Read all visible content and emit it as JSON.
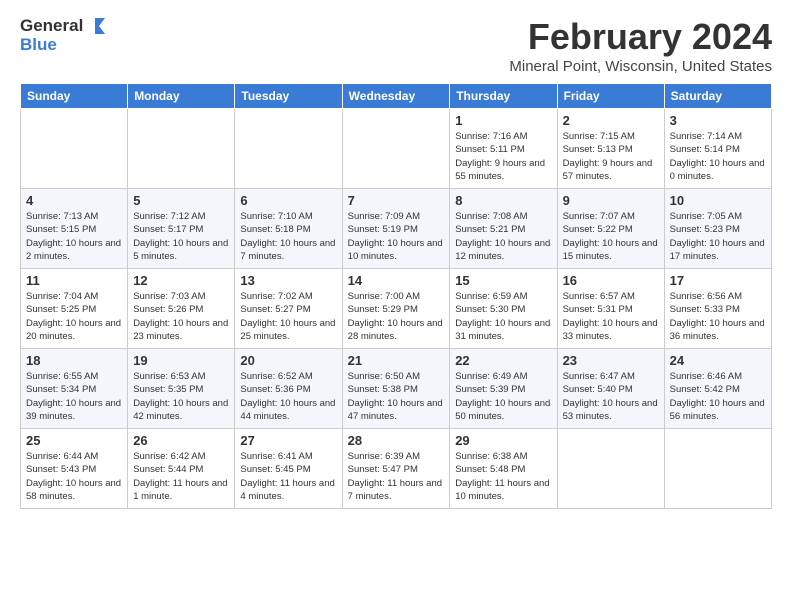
{
  "app": {
    "name_general": "General",
    "name_blue": "Blue"
  },
  "header": {
    "month_year": "February 2024",
    "location": "Mineral Point, Wisconsin, United States"
  },
  "columns": [
    "Sunday",
    "Monday",
    "Tuesday",
    "Wednesday",
    "Thursday",
    "Friday",
    "Saturday"
  ],
  "weeks": [
    [
      {
        "day": "",
        "info": ""
      },
      {
        "day": "",
        "info": ""
      },
      {
        "day": "",
        "info": ""
      },
      {
        "day": "",
        "info": ""
      },
      {
        "day": "1",
        "info": "Sunrise: 7:16 AM\nSunset: 5:11 PM\nDaylight: 9 hours and 55 minutes."
      },
      {
        "day": "2",
        "info": "Sunrise: 7:15 AM\nSunset: 5:13 PM\nDaylight: 9 hours and 57 minutes."
      },
      {
        "day": "3",
        "info": "Sunrise: 7:14 AM\nSunset: 5:14 PM\nDaylight: 10 hours and 0 minutes."
      }
    ],
    [
      {
        "day": "4",
        "info": "Sunrise: 7:13 AM\nSunset: 5:15 PM\nDaylight: 10 hours and 2 minutes."
      },
      {
        "day": "5",
        "info": "Sunrise: 7:12 AM\nSunset: 5:17 PM\nDaylight: 10 hours and 5 minutes."
      },
      {
        "day": "6",
        "info": "Sunrise: 7:10 AM\nSunset: 5:18 PM\nDaylight: 10 hours and 7 minutes."
      },
      {
        "day": "7",
        "info": "Sunrise: 7:09 AM\nSunset: 5:19 PM\nDaylight: 10 hours and 10 minutes."
      },
      {
        "day": "8",
        "info": "Sunrise: 7:08 AM\nSunset: 5:21 PM\nDaylight: 10 hours and 12 minutes."
      },
      {
        "day": "9",
        "info": "Sunrise: 7:07 AM\nSunset: 5:22 PM\nDaylight: 10 hours and 15 minutes."
      },
      {
        "day": "10",
        "info": "Sunrise: 7:05 AM\nSunset: 5:23 PM\nDaylight: 10 hours and 17 minutes."
      }
    ],
    [
      {
        "day": "11",
        "info": "Sunrise: 7:04 AM\nSunset: 5:25 PM\nDaylight: 10 hours and 20 minutes."
      },
      {
        "day": "12",
        "info": "Sunrise: 7:03 AM\nSunset: 5:26 PM\nDaylight: 10 hours and 23 minutes."
      },
      {
        "day": "13",
        "info": "Sunrise: 7:02 AM\nSunset: 5:27 PM\nDaylight: 10 hours and 25 minutes."
      },
      {
        "day": "14",
        "info": "Sunrise: 7:00 AM\nSunset: 5:29 PM\nDaylight: 10 hours and 28 minutes."
      },
      {
        "day": "15",
        "info": "Sunrise: 6:59 AM\nSunset: 5:30 PM\nDaylight: 10 hours and 31 minutes."
      },
      {
        "day": "16",
        "info": "Sunrise: 6:57 AM\nSunset: 5:31 PM\nDaylight: 10 hours and 33 minutes."
      },
      {
        "day": "17",
        "info": "Sunrise: 6:56 AM\nSunset: 5:33 PM\nDaylight: 10 hours and 36 minutes."
      }
    ],
    [
      {
        "day": "18",
        "info": "Sunrise: 6:55 AM\nSunset: 5:34 PM\nDaylight: 10 hours and 39 minutes."
      },
      {
        "day": "19",
        "info": "Sunrise: 6:53 AM\nSunset: 5:35 PM\nDaylight: 10 hours and 42 minutes."
      },
      {
        "day": "20",
        "info": "Sunrise: 6:52 AM\nSunset: 5:36 PM\nDaylight: 10 hours and 44 minutes."
      },
      {
        "day": "21",
        "info": "Sunrise: 6:50 AM\nSunset: 5:38 PM\nDaylight: 10 hours and 47 minutes."
      },
      {
        "day": "22",
        "info": "Sunrise: 6:49 AM\nSunset: 5:39 PM\nDaylight: 10 hours and 50 minutes."
      },
      {
        "day": "23",
        "info": "Sunrise: 6:47 AM\nSunset: 5:40 PM\nDaylight: 10 hours and 53 minutes."
      },
      {
        "day": "24",
        "info": "Sunrise: 6:46 AM\nSunset: 5:42 PM\nDaylight: 10 hours and 56 minutes."
      }
    ],
    [
      {
        "day": "25",
        "info": "Sunrise: 6:44 AM\nSunset: 5:43 PM\nDaylight: 10 hours and 58 minutes."
      },
      {
        "day": "26",
        "info": "Sunrise: 6:42 AM\nSunset: 5:44 PM\nDaylight: 11 hours and 1 minute."
      },
      {
        "day": "27",
        "info": "Sunrise: 6:41 AM\nSunset: 5:45 PM\nDaylight: 11 hours and 4 minutes."
      },
      {
        "day": "28",
        "info": "Sunrise: 6:39 AM\nSunset: 5:47 PM\nDaylight: 11 hours and 7 minutes."
      },
      {
        "day": "29",
        "info": "Sunrise: 6:38 AM\nSunset: 5:48 PM\nDaylight: 11 hours and 10 minutes."
      },
      {
        "day": "",
        "info": ""
      },
      {
        "day": "",
        "info": ""
      }
    ]
  ]
}
